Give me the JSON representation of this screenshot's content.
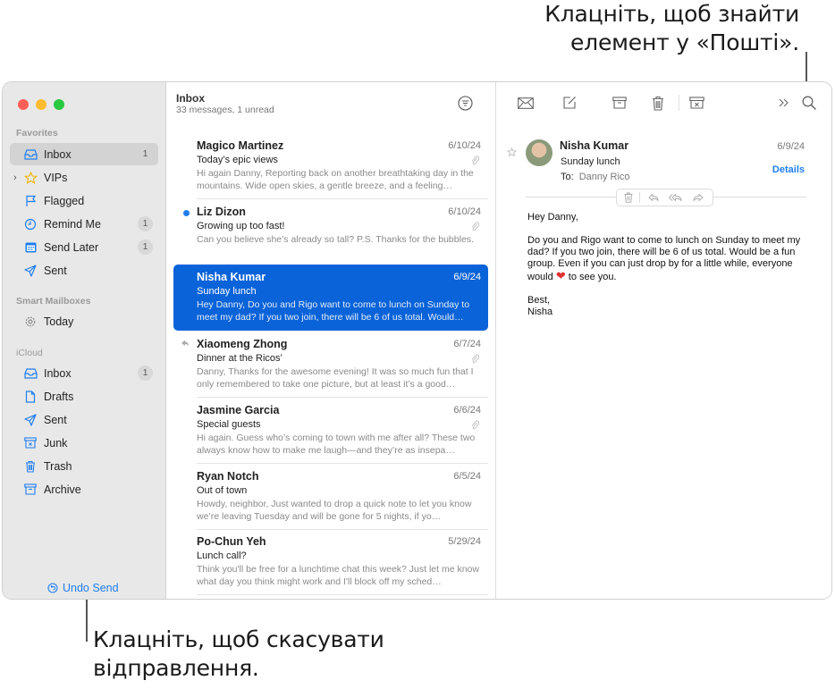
{
  "callouts": {
    "search": "Клацніть, щоб знайти елемент у «Пошті».",
    "undo_send": "Клацніть, щоб скасувати відправлення."
  },
  "colors": {
    "accent": "#1f7ef0",
    "selection": "#0a63d8",
    "sidebar_bg": "#e8e8e8"
  },
  "sidebar": {
    "favorites_label": "Favorites",
    "favorites": [
      {
        "label": "Inbox",
        "icon": "inbox-icon",
        "badge": "1",
        "selected": true
      },
      {
        "label": "VIPs",
        "icon": "star-icon",
        "badge": null,
        "disclosure": true
      },
      {
        "label": "Flagged",
        "icon": "flag-icon",
        "badge": null
      },
      {
        "label": "Remind Me",
        "icon": "clock-icon",
        "badge": "1"
      },
      {
        "label": "Send Later",
        "icon": "calendar-icon",
        "badge": "1"
      },
      {
        "label": "Sent",
        "icon": "paperplane-icon",
        "badge": null
      }
    ],
    "smart_label": "Smart Mailboxes",
    "smart": [
      {
        "label": "Today",
        "icon": "gear-icon"
      }
    ],
    "icloud_label": "iCloud",
    "icloud": [
      {
        "label": "Inbox",
        "icon": "inbox-icon",
        "badge": "1"
      },
      {
        "label": "Drafts",
        "icon": "document-icon"
      },
      {
        "label": "Sent",
        "icon": "paperplane-icon"
      },
      {
        "label": "Junk",
        "icon": "junk-icon"
      },
      {
        "label": "Trash",
        "icon": "trash-icon"
      },
      {
        "label": "Archive",
        "icon": "archive-icon"
      }
    ],
    "undo_send": "Undo Send"
  },
  "list": {
    "title": "Inbox",
    "subtitle": "33 messages, 1 unread",
    "messages": [
      {
        "sender": "Magico Martinez",
        "date": "6/10/24",
        "subject": "Today’s epic views",
        "preview": "Hi again Danny, Reporting back on another breathtaking day in the mountains. Wide open skies, a gentle breeze, and a feeling…",
        "attachment": true
      },
      {
        "sender": "Liz Dizon",
        "date": "6/10/24",
        "subject": "Growing up too fast!",
        "preview": "Can you believe she’s already so tall? P.S. Thanks for the bubbles.",
        "attachment": true,
        "unread": true
      },
      {
        "sender": "Nisha Kumar",
        "date": "6/9/24",
        "subject": "Sunday lunch",
        "preview": "Hey Danny, Do you and Rigo want to come to lunch on Sunday to meet my dad? If you two join, there will be 6 of us total. Would…",
        "selected": true
      },
      {
        "sender": "Xiaomeng Zhong",
        "date": "6/7/24",
        "subject": "Dinner at the Ricos’",
        "preview": "Danny, Thanks for the awesome evening! It was so much fun that I only remembered to take one picture, but at least it’s a good…",
        "attachment": true,
        "replied": true
      },
      {
        "sender": "Jasmine Garcia",
        "date": "6/6/24",
        "subject": "Special guests",
        "preview": "Hi again. Guess who’s coming to town with me after all? These two always know how to make me laugh—and they’re as insepa…",
        "attachment": true
      },
      {
        "sender": "Ryan Notch",
        "date": "6/5/24",
        "subject": "Out of town",
        "preview": "Howdy, neighbor, Just wanted to drop a quick note to let you know we’re leaving Tuesday and will be gone for 5 nights, if yo…"
      },
      {
        "sender": "Po-Chun Yeh",
        "date": "5/29/24",
        "subject": "Lunch call?",
        "preview": "Think you'll be free for a lunchtime chat this week? Just let me know what day you think might work and I'll block off my sched…"
      }
    ]
  },
  "toolbar": {
    "icons": [
      "envelope-icon",
      "compose-icon",
      "archive-icon",
      "trash-icon",
      "junk-icon",
      "more-icon",
      "search-icon"
    ]
  },
  "reader": {
    "sender": "Nisha Kumar",
    "date": "6/9/24",
    "subject": "Sunday lunch",
    "to_label": "To:",
    "to_value": "Danny Rico",
    "details": "Details",
    "body": {
      "greeting": "Hey Danny,",
      "para_before_heart": "Do you and Rigo want to come to lunch on Sunday to meet my dad? If you two join, there will be 6 of us total. Would be a fun group. Even if you can just drop by for a little while, everyone would",
      "heart": "❤",
      "para_after_heart": " to see you.",
      "closing": "Best,",
      "signature": "Nisha"
    }
  }
}
